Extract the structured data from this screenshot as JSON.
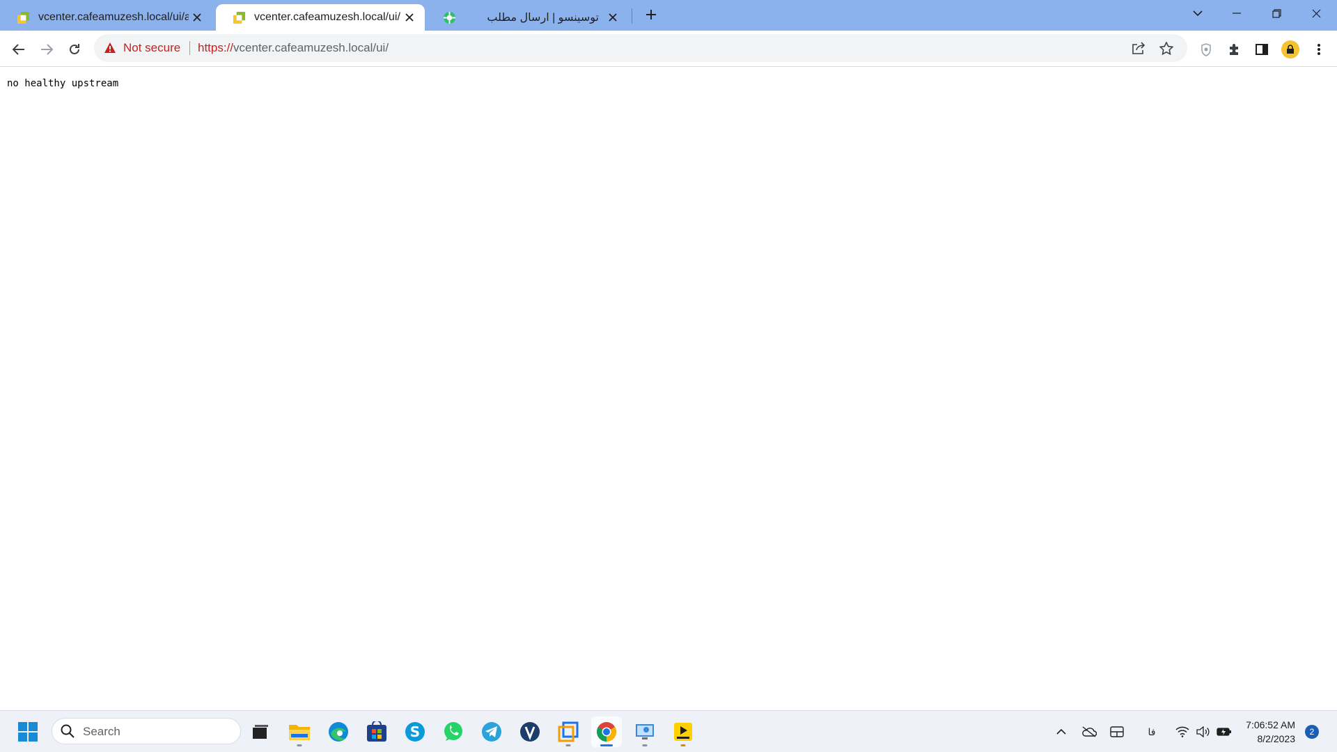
{
  "browser": {
    "tabs": [
      {
        "title": "vcenter.cafeamuzesh.local/ui/app",
        "active": false,
        "icon": "vsphere-icon"
      },
      {
        "title": "vcenter.cafeamuzesh.local/ui/",
        "active": true,
        "icon": "vsphere-icon"
      },
      {
        "title": "توسینسو | ارسال مطلب",
        "active": false,
        "icon": "tosinso-icon"
      }
    ],
    "address_bar": {
      "security_label": "Not secure",
      "url_scheme": "https://",
      "url_rest": "vcenter.cafeamuzesh.local/ui/"
    }
  },
  "page": {
    "error_text": "no healthy upstream"
  },
  "taskbar": {
    "search_placeholder": "Search",
    "apps": [
      "file-explorer-icon",
      "edge-icon",
      "store-icon",
      "skype-icon",
      "whatsapp-icon",
      "telegram-icon",
      "vk-icon",
      "vmware-icon",
      "chrome-icon",
      "remote-desktop-icon",
      "player-icon"
    ],
    "tray": {
      "language": "فا",
      "time": "7:06:52 AM",
      "date": "8/2/2023",
      "notification_count": "2"
    }
  },
  "colors": {
    "tabstrip": "#8cb2ee",
    "not_secure": "#c5221f",
    "accent": "#1a73e8"
  }
}
